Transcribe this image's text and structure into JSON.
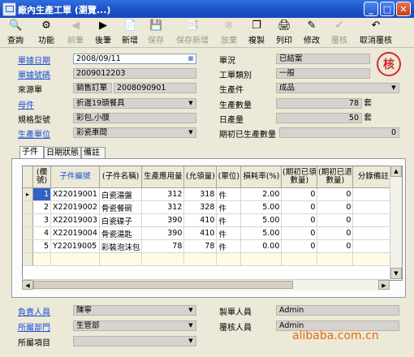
{
  "window": {
    "title": "廠內生產工單 (瀏覽...)",
    "min": "_",
    "max": "□",
    "close": "✕"
  },
  "toolbar": [
    {
      "label": "查詢",
      "icon": "🔍",
      "enabled": true
    },
    {
      "label": "功能",
      "icon": "⚙",
      "enabled": true
    },
    {
      "label": "前筆",
      "icon": "◀",
      "enabled": false
    },
    {
      "label": "後筆",
      "icon": "▶",
      "enabled": true
    },
    {
      "label": "新增",
      "icon": "📄",
      "enabled": true
    },
    {
      "label": "保存",
      "icon": "💾",
      "enabled": false
    },
    {
      "label": "保存新增",
      "icon": "📑",
      "enabled": false
    },
    {
      "label": "放棄",
      "icon": "⊗",
      "enabled": false
    },
    {
      "label": "複製",
      "icon": "❐",
      "enabled": true
    },
    {
      "label": "列印",
      "icon": "🖨",
      "enabled": true
    },
    {
      "label": "修改",
      "icon": "✎",
      "enabled": true
    },
    {
      "label": "覆核",
      "icon": "✔",
      "enabled": false
    },
    {
      "label": "取消覆核",
      "icon": "↶",
      "enabled": true
    }
  ],
  "form": {
    "order_date_label": "單據日期",
    "order_date": "2008/09/11",
    "order_no_label": "單據號碼",
    "order_no": "2009012203",
    "source_label": "來源單",
    "source_type": "銷售訂單",
    "source_no": "2008090901",
    "part_label": "母件",
    "part": "折邊19頭餐具",
    "spec_label": "規格型號",
    "spec": "彩包,小膜",
    "unit_label": "生產單位",
    "unit": "彩瓷車間",
    "status_label": "單況",
    "status": "已結案",
    "type_label": "工單類別",
    "type": "一般",
    "product_label": "生產件",
    "product": "成品",
    "qty_label": "生產數量",
    "qty": "78",
    "qty_unit": "套",
    "daily_label": "日產量",
    "daily": "50",
    "daily_unit": "套",
    "initial_label": "期初已生產數量",
    "initial": "0",
    "stamp": "核"
  },
  "tabs": [
    "子件",
    "日期狀態",
    "備註"
  ],
  "grid": {
    "headers": [
      "(欄號)",
      "子件編號",
      "(子件名稱)",
      "生產應用量",
      "(允領量)",
      "(單位)",
      "損耗率(%)",
      "(期初已領數量)",
      "(期初已退數量)",
      "分錄備註"
    ],
    "rows": [
      [
        "1",
        "X22019001",
        "白瓷湯盤",
        "312",
        "318",
        "件",
        "2.00",
        "0",
        "0",
        ""
      ],
      [
        "2",
        "X22019002",
        "骨瓷餐碗",
        "312",
        "328",
        "件",
        "5.00",
        "0",
        "0",
        ""
      ],
      [
        "3",
        "X22019003",
        "白瓷碟子",
        "390",
        "410",
        "件",
        "5.00",
        "0",
        "0",
        ""
      ],
      [
        "4",
        "X22019004",
        "骨瓷湯匙",
        "390",
        "410",
        "件",
        "5.00",
        "0",
        "0",
        ""
      ],
      [
        "5",
        "Y22019005",
        "彩裝泡沫包",
        "78",
        "78",
        "件",
        "0.00",
        "0",
        "0",
        ""
      ]
    ]
  },
  "footer": {
    "owner_label": "負責人員",
    "owner": "陳寧",
    "dept_label": "所屬部門",
    "dept": "生管部",
    "project_label": "所屬項目",
    "project": "",
    "maker_label": "製單人員",
    "maker": "Admin",
    "reviewer_label": "覆核人員",
    "reviewer": "Admin"
  },
  "watermark": "alibaba.com.cn"
}
